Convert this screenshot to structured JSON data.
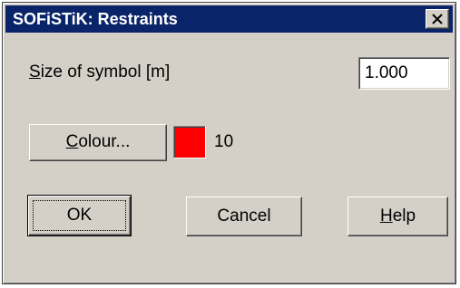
{
  "window": {
    "title": "SOFiSTiK: Restraints",
    "close_icon": "close-icon"
  },
  "size_field": {
    "label_prefix": "S",
    "label_rest": "ize of symbol [m]",
    "value": "1.000"
  },
  "colour": {
    "button_underlined": "C",
    "button_rest": "olour...",
    "swatch_color": "#ff0000",
    "index": "10"
  },
  "buttons": {
    "ok": "OK",
    "cancel": "Cancel",
    "help_underlined": "H",
    "help_rest": "elp"
  }
}
